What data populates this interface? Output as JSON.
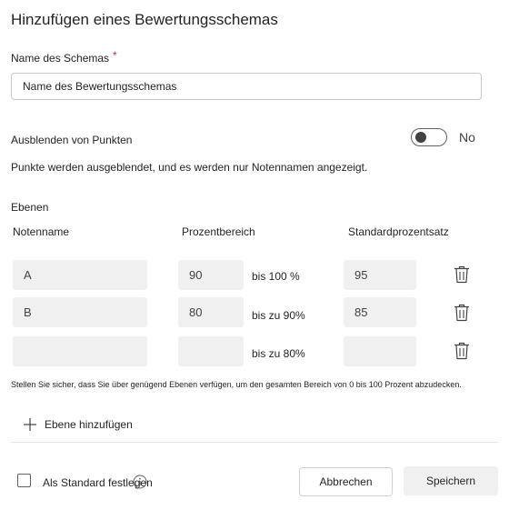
{
  "dialog": {
    "title": "Hinzufügen eines Bewertungsschemas"
  },
  "schema_name": {
    "label": "Name des Schemas",
    "required_mark": "*",
    "placeholder": "Name des Bewertungsschemas"
  },
  "hide_points": {
    "label": "Ausblenden von Punkten",
    "state_text": "No",
    "on": false,
    "description": "Punkte werden ausgeblendet, und es werden nur Notennamen angezeigt."
  },
  "levels": {
    "section_label": "Ebenen",
    "columns": [
      "Notenname",
      "Prozentbereich",
      "Standardprozentsatz"
    ],
    "rows": [
      {
        "name": "A",
        "percent_from": "90",
        "range_text": "bis 100 %",
        "default_percent": "95"
      },
      {
        "name": "B",
        "percent_from": "80",
        "range_text": "bis zu 90%",
        "default_percent": "85"
      },
      {
        "name": "",
        "percent_from": "",
        "range_text": "bis zu 80%",
        "default_percent": ""
      }
    ],
    "coverage_note": "Stellen Sie sicher, dass Sie über genügend Ebenen verfügen, um den gesamten Bereich von 0 bis 100 Prozent abzudecken.",
    "add_level_label": "Ebene hinzufügen"
  },
  "footer": {
    "set_default_label": "Als Standard festlegen",
    "cancel_label": "Abbrechen",
    "save_label": "Speichern"
  }
}
